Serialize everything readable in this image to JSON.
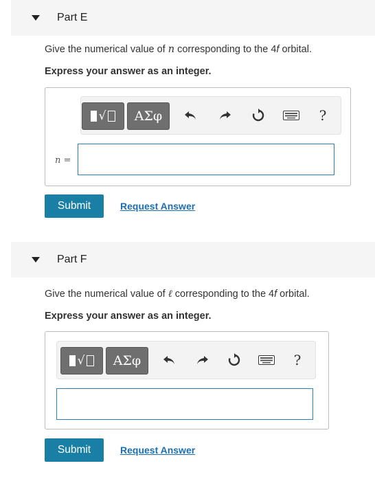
{
  "parts": [
    {
      "title": "Part E",
      "prompt_before": "Give the numerical value of ",
      "variable": "n",
      "prompt_mid": " corresponding to the 4",
      "orbital_letter": "f",
      "prompt_after": " orbital.",
      "instruction": "Express your answer as an integer.",
      "toolbar": {
        "symbols_label": "ΑΣφ",
        "help_label": "?"
      },
      "input_label": "n =",
      "input_value": "",
      "submit_label": "Submit",
      "request_label": "Request Answer"
    },
    {
      "title": "Part F",
      "prompt_before": "Give the numerical value of ",
      "variable": "ℓ",
      "prompt_mid": " corresponding to the 4",
      "orbital_letter": "f",
      "prompt_after": " orbital.",
      "instruction": "Express your answer as an integer.",
      "toolbar": {
        "symbols_label": "ΑΣφ",
        "help_label": "?"
      },
      "input_label": "",
      "input_value": "",
      "submit_label": "Submit",
      "request_label": "Request Answer"
    }
  ],
  "colors": {
    "accent": "#1a7fa5",
    "link": "#1c6fb0",
    "header_bg": "#f5f5f5"
  }
}
